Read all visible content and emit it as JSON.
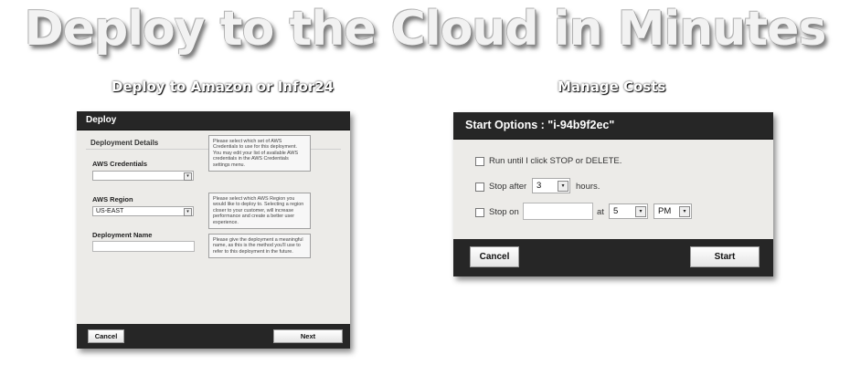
{
  "headline": "Deploy to the Cloud in Minutes",
  "left_caption": "Deploy to Amazon or Infor24",
  "right_caption": "Manage Costs",
  "deploy_dialog": {
    "title": "Deploy",
    "section": "Deployment Details",
    "aws_credentials": {
      "label": "AWS Credentials",
      "value": "",
      "help": "Please select which set of AWS Credentials to use for this deployment. You may edit your list of available AWS credentials in the AWS Credentials settings menu."
    },
    "aws_region": {
      "label": "AWS Region",
      "value": "US-EAST",
      "help": "Please select which AWS Region you would like to deploy to. Selecting a region closer to your customer, will increase performance and create a better user experience."
    },
    "deployment_name": {
      "label": "Deployment Name",
      "value": "",
      "help": "Please give the deployment a meaningful name, as this is the method you'll use to refer to this deployment in the future."
    },
    "cancel_label": "Cancel",
    "next_label": "Next"
  },
  "start_dialog": {
    "title": "Start Options : \"i-94b9f2ec\"",
    "option_run": "Run until I click STOP or DELETE.",
    "option_stop_after": "Stop after",
    "stop_after_value": "3",
    "hours_label": "hours.",
    "option_stop_on": "Stop on",
    "stop_on_date": "",
    "at_label": "at",
    "hour_value": "5",
    "ampm_value": "PM",
    "cancel_label": "Cancel",
    "start_label": "Start"
  },
  "icons": {
    "dropdown_arrow": "▾"
  }
}
